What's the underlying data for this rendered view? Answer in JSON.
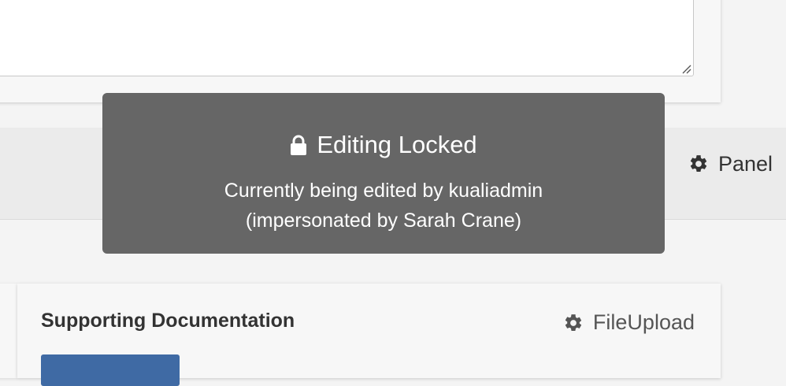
{
  "panel": {
    "label": "Panel",
    "icon": "gear-icon"
  },
  "document_section": {
    "title": "Supporting Documentation",
    "type_label": "FileUpload",
    "type_icon": "gear-icon",
    "button_color": "#3f6aa4"
  },
  "lock_overlay": {
    "icon": "lock-icon",
    "title": "Editing Locked",
    "line1": "Currently being edited by kualiadmin",
    "line2": "(impersonated by Sarah Crane)",
    "background": "#666666"
  }
}
